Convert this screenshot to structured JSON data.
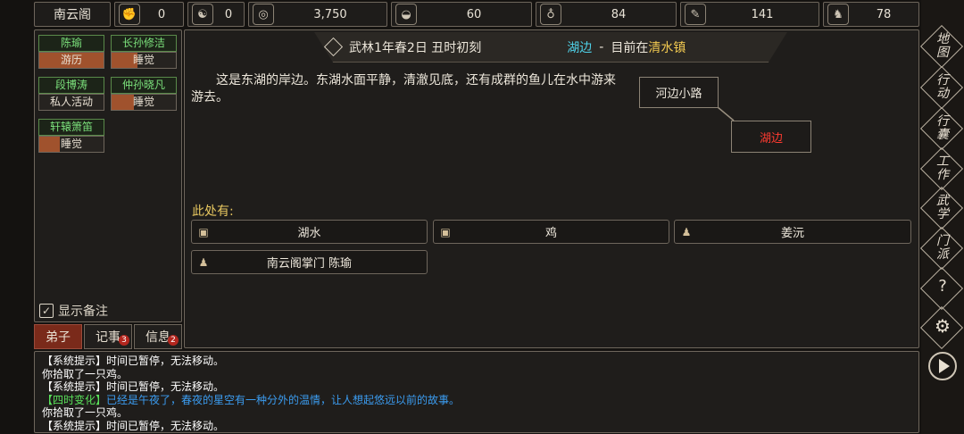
{
  "sect_name": "南云阁",
  "resources": [
    {
      "icon": "fist-icon",
      "glyph": "✊",
      "value": "0"
    },
    {
      "icon": "yin-yang-icon",
      "glyph": "☯",
      "value": "0"
    },
    {
      "icon": "coin-icon",
      "glyph": "◎",
      "value": "3,750"
    },
    {
      "icon": "rice-bowl-icon",
      "glyph": "◒",
      "value": "60"
    },
    {
      "icon": "gourd-icon",
      "glyph": "♁",
      "value": "84"
    },
    {
      "icon": "scroll-icon",
      "glyph": "✎",
      "value": "141"
    },
    {
      "icon": "horse-icon",
      "glyph": "♞",
      "value": "78"
    }
  ],
  "disciples": [
    {
      "name": "陈瑜",
      "status": "游历",
      "progress": 1.0
    },
    {
      "name": "长孙修洁",
      "status": "睡觉",
      "progress": 0.4
    },
    {
      "name": "段博涛",
      "status": "私人活动",
      "progress": 0.0
    },
    {
      "name": "仲孙晓凡",
      "status": "睡觉",
      "progress": 0.35
    },
    {
      "name": "轩辕箫笛",
      "status": "睡觉",
      "progress": 0.32
    }
  ],
  "show_notes_label": "显示备注",
  "tabs": [
    {
      "label": "弟子",
      "badge": ""
    },
    {
      "label": "记事",
      "badge": "3"
    },
    {
      "label": "信息",
      "badge": "2"
    }
  ],
  "header": {
    "date": "武林1年春2日 丑时初刻",
    "location": "湖边",
    "separator": "-",
    "current_prefix": "目前在",
    "town": "清水镇"
  },
  "description": "这是东湖的岸边。东湖水面平静，清澈见底，还有成群的鱼儿在水中游来游去。",
  "map": {
    "road": "河边小路",
    "current": "湖边"
  },
  "here_label": "此处有:",
  "entities": [
    {
      "icon": "box-icon",
      "glyph": "▣",
      "label": "湖水"
    },
    {
      "icon": "box-icon",
      "glyph": "▣",
      "label": "鸡"
    },
    {
      "icon": "person-icon",
      "glyph": "♟",
      "label": "姜沅"
    },
    {
      "icon": "person-icon",
      "glyph": "♟",
      "label": "南云阁掌门 陈瑜"
    }
  ],
  "right_nav": [
    "地图",
    "行动",
    "行囊",
    "工作",
    "武学",
    "门派"
  ],
  "log": [
    {
      "tag": "【系统提示】",
      "text": "时间已暂停，无法移动。",
      "color": "#ffffff",
      "tag_color": "#ffffff"
    },
    {
      "tag": "",
      "text": "你拾取了一只鸡。",
      "color": "#ffffff",
      "tag_color": "#ffffff"
    },
    {
      "tag": "【系统提示】",
      "text": "时间已暂停，无法移动。",
      "color": "#ffffff",
      "tag_color": "#ffffff"
    },
    {
      "tag": "【四时变化】",
      "text": "已经是午夜了，春夜的星空有一种分外的温情，让人想起悠远以前的故事。",
      "color": "#3b9cf0",
      "tag_color": "#59e05a"
    },
    {
      "tag": "",
      "text": "你拾取了一只鸡。",
      "color": "#ffffff",
      "tag_color": "#ffffff"
    },
    {
      "tag": "【系统提示】",
      "text": "时间已暂停，无法移动。",
      "color": "#ffffff",
      "tag_color": "#ffffff"
    }
  ]
}
